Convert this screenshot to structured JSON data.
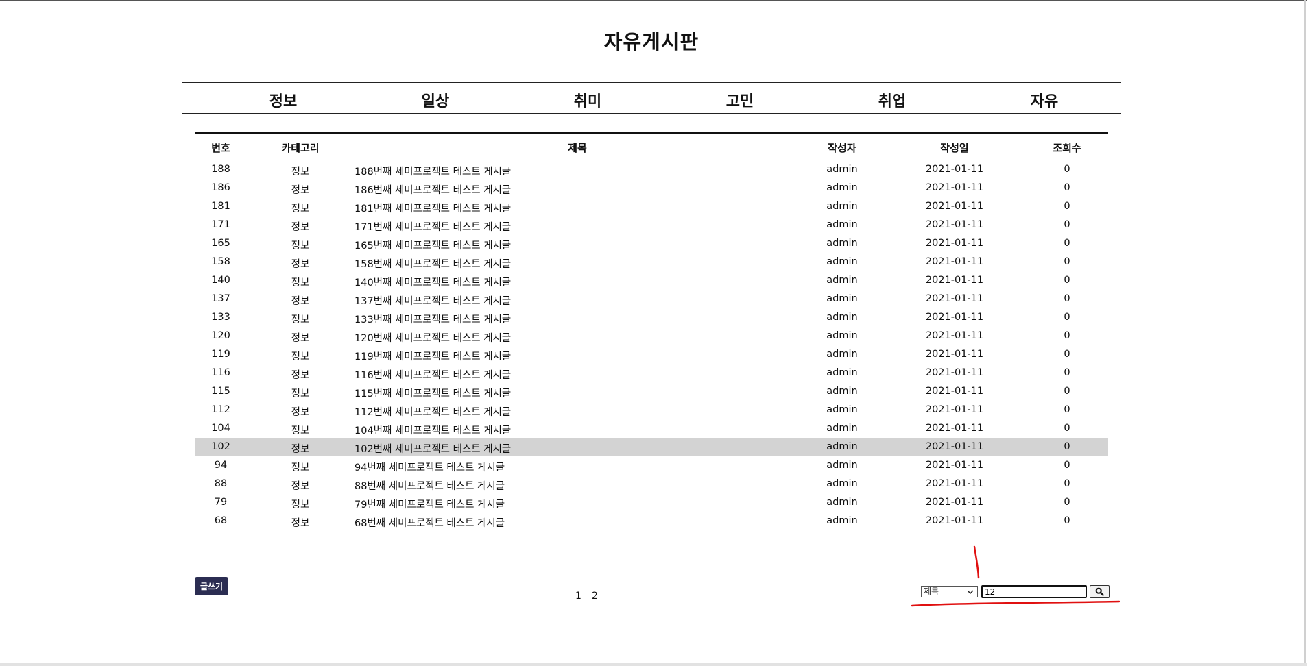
{
  "page": {
    "title": "자유게시판"
  },
  "nav": [
    {
      "label": "정보"
    },
    {
      "label": "일상"
    },
    {
      "label": "취미"
    },
    {
      "label": "고민"
    },
    {
      "label": "취업"
    },
    {
      "label": "자유"
    }
  ],
  "table": {
    "headers": {
      "no": "번호",
      "category": "카테고리",
      "title": "제목",
      "author": "작성자",
      "date": "작성일",
      "views": "조회수"
    },
    "rows": [
      {
        "no": "188",
        "category": "정보",
        "title": "188번째 세미프로젝트 테스트 게시글",
        "author": "admin",
        "date": "2021-01-11",
        "views": "0"
      },
      {
        "no": "186",
        "category": "정보",
        "title": "186번째 세미프로젝트 테스트 게시글",
        "author": "admin",
        "date": "2021-01-11",
        "views": "0"
      },
      {
        "no": "181",
        "category": "정보",
        "title": "181번째 세미프로젝트 테스트 게시글",
        "author": "admin",
        "date": "2021-01-11",
        "views": "0"
      },
      {
        "no": "171",
        "category": "정보",
        "title": "171번째 세미프로젝트 테스트 게시글",
        "author": "admin",
        "date": "2021-01-11",
        "views": "0"
      },
      {
        "no": "165",
        "category": "정보",
        "title": "165번째 세미프로젝트 테스트 게시글",
        "author": "admin",
        "date": "2021-01-11",
        "views": "0"
      },
      {
        "no": "158",
        "category": "정보",
        "title": "158번째 세미프로젝트 테스트 게시글",
        "author": "admin",
        "date": "2021-01-11",
        "views": "0"
      },
      {
        "no": "140",
        "category": "정보",
        "title": "140번째 세미프로젝트 테스트 게시글",
        "author": "admin",
        "date": "2021-01-11",
        "views": "0"
      },
      {
        "no": "137",
        "category": "정보",
        "title": "137번째 세미프로젝트 테스트 게시글",
        "author": "admin",
        "date": "2021-01-11",
        "views": "0"
      },
      {
        "no": "133",
        "category": "정보",
        "title": "133번째 세미프로젝트 테스트 게시글",
        "author": "admin",
        "date": "2021-01-11",
        "views": "0"
      },
      {
        "no": "120",
        "category": "정보",
        "title": "120번째 세미프로젝트 테스트 게시글",
        "author": "admin",
        "date": "2021-01-11",
        "views": "0"
      },
      {
        "no": "119",
        "category": "정보",
        "title": "119번째 세미프로젝트 테스트 게시글",
        "author": "admin",
        "date": "2021-01-11",
        "views": "0"
      },
      {
        "no": "116",
        "category": "정보",
        "title": "116번째 세미프로젝트 테스트 게시글",
        "author": "admin",
        "date": "2021-01-11",
        "views": "0"
      },
      {
        "no": "115",
        "category": "정보",
        "title": "115번째 세미프로젝트 테스트 게시글",
        "author": "admin",
        "date": "2021-01-11",
        "views": "0"
      },
      {
        "no": "112",
        "category": "정보",
        "title": "112번째 세미프로젝트 테스트 게시글",
        "author": "admin",
        "date": "2021-01-11",
        "views": "0"
      },
      {
        "no": "104",
        "category": "정보",
        "title": "104번째 세미프로젝트 테스트 게시글",
        "author": "admin",
        "date": "2021-01-11",
        "views": "0"
      },
      {
        "no": "102",
        "category": "정보",
        "title": "102번째 세미프로젝트 테스트 게시글",
        "author": "admin",
        "date": "2021-01-11",
        "views": "0"
      },
      {
        "no": "94",
        "category": "정보",
        "title": "94번째 세미프로젝트 테스트 게시글",
        "author": "admin",
        "date": "2021-01-11",
        "views": "0"
      },
      {
        "no": "88",
        "category": "정보",
        "title": "88번째 세미프로젝트 테스트 게시글",
        "author": "admin",
        "date": "2021-01-11",
        "views": "0"
      },
      {
        "no": "79",
        "category": "정보",
        "title": "79번째 세미프로젝트 테스트 게시글",
        "author": "admin",
        "date": "2021-01-11",
        "views": "0"
      },
      {
        "no": "68",
        "category": "정보",
        "title": "68번째 세미프로젝트 테스트 게시글",
        "author": "admin",
        "date": "2021-01-11",
        "views": "0"
      }
    ]
  },
  "write_button": {
    "label": "글쓰기"
  },
  "pagination": {
    "pages": [
      "1",
      "2"
    ]
  },
  "search": {
    "field_selected": "제목",
    "query": "12",
    "button_icon": "search-icon"
  },
  "colors": {
    "write_button_bg": "#2b2d52",
    "highlight_row": "#d3d3d3",
    "annotation": "#e01010"
  }
}
